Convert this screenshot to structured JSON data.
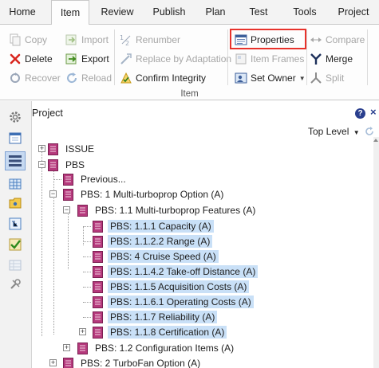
{
  "tabs": [
    "Home",
    "Item",
    "Review",
    "Publish",
    "Plan",
    "Test",
    "Tools",
    "Project"
  ],
  "active_tab": "Item",
  "ribbon": {
    "copy": "Copy",
    "delete": "Delete",
    "recover": "Recover",
    "import": "Import",
    "export": "Export",
    "reload": "Reload",
    "renumber": "Renumber",
    "replace_by_adaptation": "Replace by Adaptation",
    "confirm_integrity": "Confirm Integrity",
    "properties": "Properties",
    "item_frames": "Item Frames",
    "set_owner": "Set Owner",
    "compare": "Compare",
    "merge": "Merge",
    "split": "Split",
    "group_label": "Item"
  },
  "panel": {
    "title": "Project",
    "help": "?",
    "close": "×",
    "top_level": "Top Level"
  },
  "tree": [
    {
      "label": "ISSUE",
      "selected": false
    },
    {
      "label": "PBS",
      "selected": false
    },
    {
      "label": "Previous...",
      "selected": false
    },
    {
      "label": "PBS: 1 Multi-turboprop Option (A)",
      "selected": false
    },
    {
      "label": "PBS: 1.1 Multi-turboprop Features (A)",
      "selected": false
    },
    {
      "label": "PBS: 1.1.1 Capacity (A)",
      "selected": true
    },
    {
      "label": "PBS: 1.1.2.2 Range (A)",
      "selected": true
    },
    {
      "label": "PBS: 4 Cruise Speed (A)",
      "selected": true
    },
    {
      "label": "PBS: 1.1.4.2 Take-off Distance (A)",
      "selected": true
    },
    {
      "label": "PBS: 1.1.5 Acquisition Costs (A)",
      "selected": true
    },
    {
      "label": "PBS: 1.1.6.1 Operating Costs (A)",
      "selected": true
    },
    {
      "label": "PBS: 1.1.7 Reliability (A)",
      "selected": true
    },
    {
      "label": "PBS: 1.1.8 Certification (A)",
      "selected": true
    },
    {
      "label": "PBS: 1.2 Configuration Items (A)",
      "selected": false
    },
    {
      "label": "PBS: 2 TurboFan Option (A)",
      "selected": false
    }
  ],
  "colors": {
    "accent": "#2a3f8e",
    "highlight_box": "#e8322b",
    "selection": "#c9e0f7",
    "item_icon": "#b5397c",
    "delete_x": "#d8251d"
  }
}
